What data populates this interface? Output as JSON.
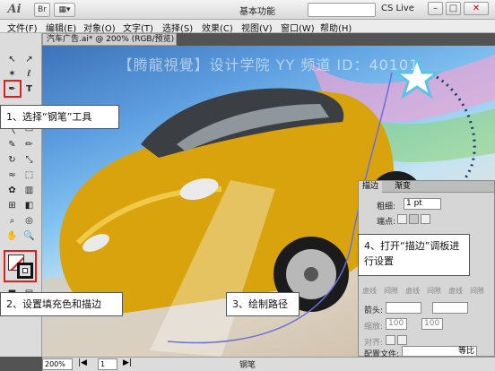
{
  "app": {
    "logo": "Ai",
    "workspace_label": "基本功能",
    "cs_live": "CS Live"
  },
  "menu": [
    "文件(F)",
    "编辑(E)",
    "对象(O)",
    "文字(T)",
    "选择(S)",
    "效果(C)",
    "视图(V)",
    "窗口(W)",
    "帮助(H)"
  ],
  "document": {
    "tab_label": "汽车广告.ai* @ 200% (RGB/预览)",
    "zoom": "200%",
    "page": "1",
    "status_tool": "钢笔"
  },
  "watermark": "【腾龍視覺】设计学院 YY 频道 ID：40101",
  "callouts": {
    "step1": "1、选择“钢笔”工具",
    "step2": "2、设置填充色和描边",
    "step3": "3、绘制路径",
    "step4_line1": "4、打开“描边”调板进",
    "step4_line2": "行设置"
  },
  "stroke_panel": {
    "tab_stroke": "描边",
    "tab_gradient": "渐变",
    "weight_label": "粗细:",
    "weight_value": "1 pt",
    "cap_label": "端点:",
    "arrow_label": "箭头:",
    "scale_label": "缩放:",
    "scale_a": "100",
    "scale_b": "100",
    "align_label": "对齐:",
    "profile_label": "配置文件:",
    "profile_value": "等比",
    "dash_cells": [
      "虚线",
      "间隙",
      "虚线",
      "间隙",
      "虚线",
      "间隙"
    ]
  },
  "colors": {
    "highlight": "#e21f1f",
    "path": "#6a6fd8"
  }
}
